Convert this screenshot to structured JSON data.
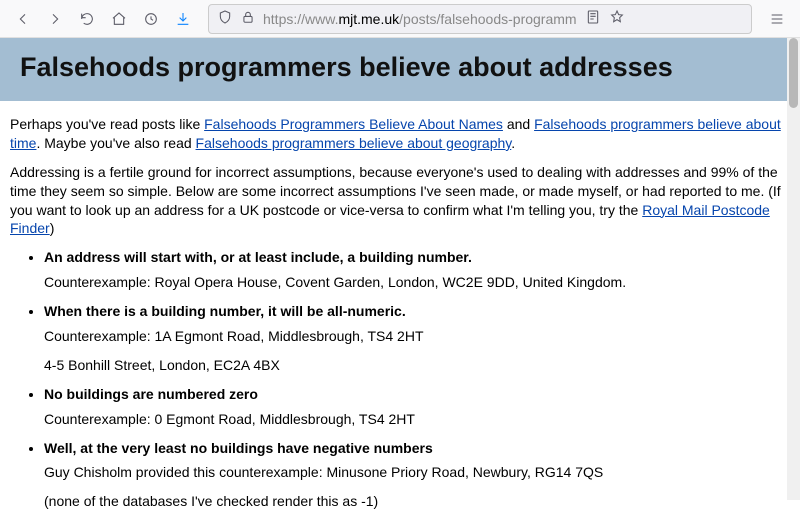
{
  "url": {
    "prefix": "https://www.",
    "host": "mjt.me.uk",
    "suffix": "/posts/falsehoods-programm"
  },
  "page": {
    "title": "Falsehoods programmers believe about addresses",
    "intro1_pre": "Perhaps you've read posts like ",
    "link_names": "Falsehoods Programmers Believe About Names",
    "intro1_mid": " and ",
    "link_time": "Falsehoods programmers believe about time",
    "intro1_post": ". Maybe you've also read ",
    "link_geo": "Falsehoods programmers believe about geography",
    "intro1_end": ".",
    "intro2_pre": "Addressing is a fertile ground for incorrect assumptions, because everyone's used to dealing with addresses and 99% of the time they seem so simple. Below are some incorrect assumptions I've seen made, or made myself, or had reported to me. (If you want to look up an address for a UK postcode or vice-versa to confirm what I'm telling you, try the ",
    "link_royal": "Royal Mail Postcode Finder",
    "intro2_post": ")",
    "items": [
      {
        "title": "An address will start with, or at least include, a building number.",
        "subs": [
          "Counterexample: Royal Opera House, Covent Garden, London, WC2E 9DD, United Kingdom."
        ]
      },
      {
        "title": "When there is a building number, it will be all-numeric.",
        "subs": [
          "Counterexample: 1A Egmont Road, Middlesbrough, TS4 2HT",
          "4-5 Bonhill Street, London, EC2A 4BX"
        ]
      },
      {
        "title": "No buildings are numbered zero",
        "subs": [
          "Counterexample: 0 Egmont Road, Middlesbrough, TS4 2HT"
        ]
      },
      {
        "title": "Well, at the very least no buildings have negative numbers",
        "subs": [
          "Guy Chisholm provided this counterexample: Minusone Priory Road, Newbury, RG14 7QS",
          "(none of the databases I've checked render this as -1)"
        ]
      }
    ]
  }
}
